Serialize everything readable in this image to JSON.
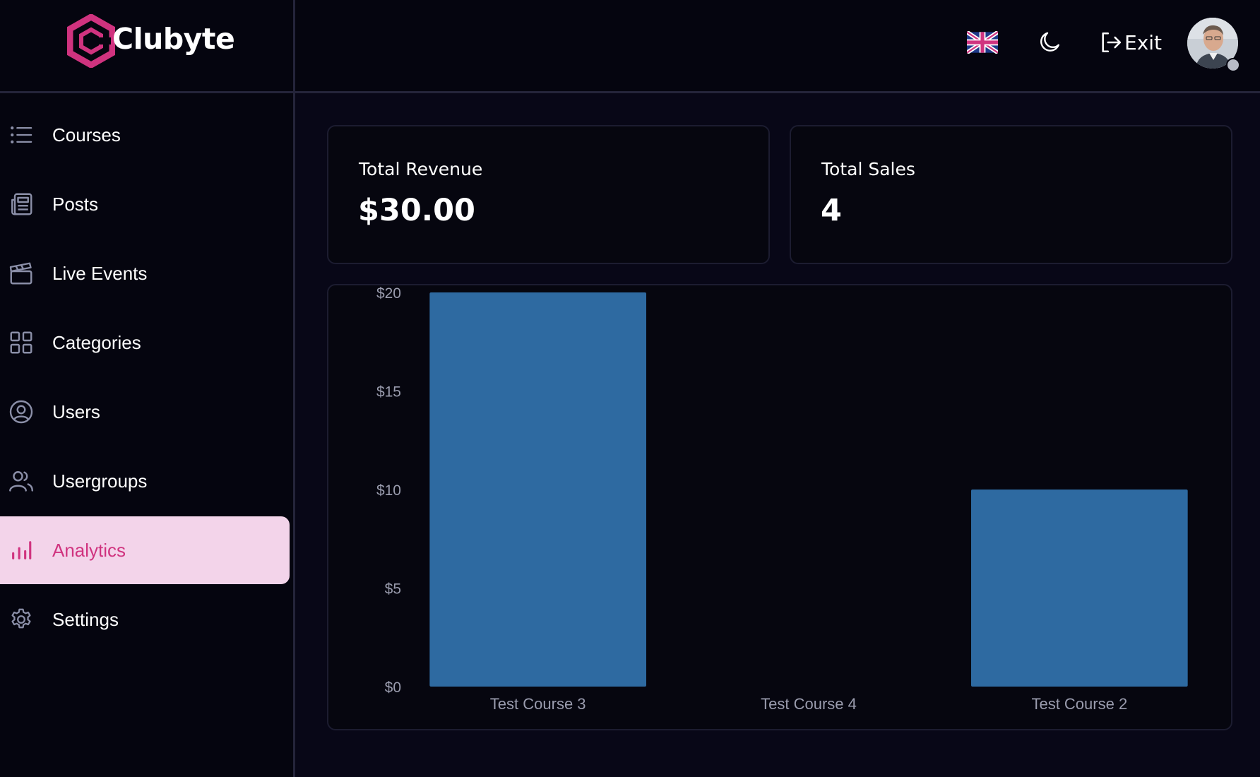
{
  "app": {
    "name": "Clubyte"
  },
  "header": {
    "language_icon": "uk-flag-icon",
    "theme_icon": "moon-icon",
    "exit_label": "Exit"
  },
  "sidebar": {
    "items": [
      {
        "label": "Courses",
        "icon": "list-icon",
        "active": false
      },
      {
        "label": "Posts",
        "icon": "newspaper-icon",
        "active": false
      },
      {
        "label": "Live Events",
        "icon": "clapperboard-icon",
        "active": false
      },
      {
        "label": "Categories",
        "icon": "grid-icon",
        "active": false
      },
      {
        "label": "Users",
        "icon": "user-circle-icon",
        "active": false
      },
      {
        "label": "Usergroups",
        "icon": "users-icon",
        "active": false
      },
      {
        "label": "Analytics",
        "icon": "bar-chart-icon",
        "active": true
      },
      {
        "label": "Settings",
        "icon": "gear-icon",
        "active": false
      }
    ]
  },
  "stats": {
    "revenue": {
      "label": "Total Revenue",
      "value": "$30.00"
    },
    "sales": {
      "label": "Total Sales",
      "value": "4"
    }
  },
  "colors": {
    "accent": "#d0337f",
    "active_bg": "#f3d4ea",
    "bar": "#2e6aa1",
    "background": "#080717"
  },
  "chart_data": {
    "type": "bar",
    "categories": [
      "Test Course 3",
      "Test Course 4",
      "Test Course 2"
    ],
    "values": [
      20,
      0,
      10
    ],
    "yticks": [
      "$0",
      "$5",
      "$10",
      "$15",
      "$20"
    ],
    "ylim": [
      0,
      20
    ],
    "grid": false,
    "legend": "none"
  }
}
